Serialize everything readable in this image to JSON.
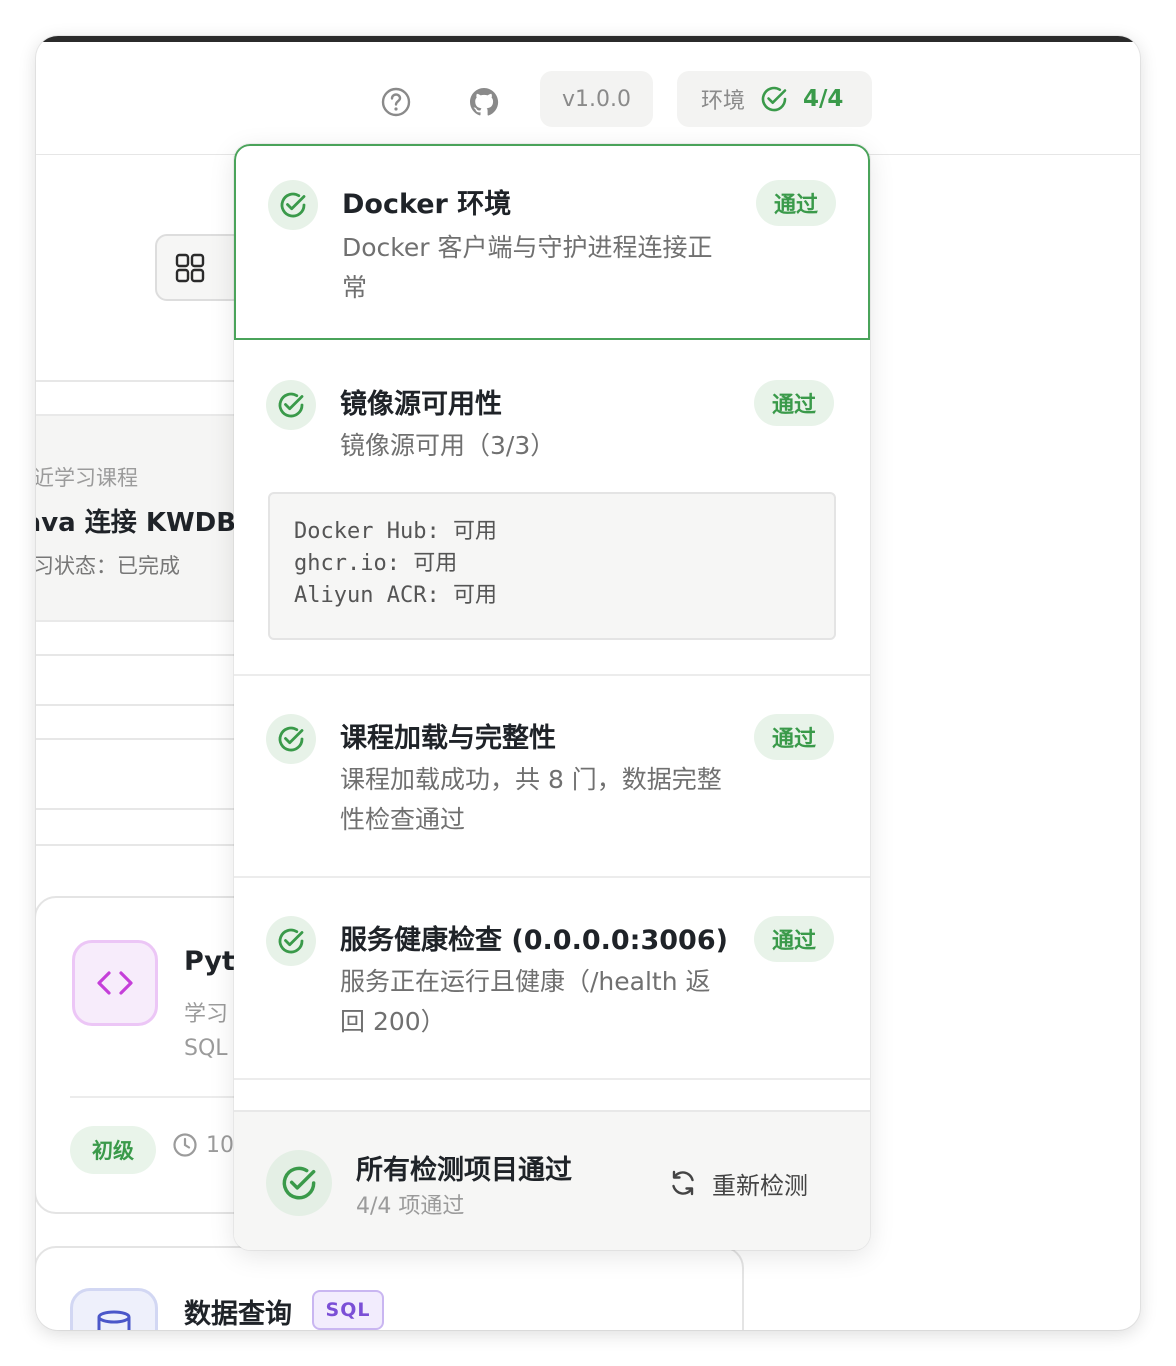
{
  "header": {
    "version": "v1.0.0",
    "env_label": "环境",
    "env_count": "4/4"
  },
  "background": {
    "recent_label": "最近学习课程",
    "recent_title": "Java 连接 KWDB",
    "recent_status": "学习状态：已完成",
    "course_title": "Python",
    "course_sub1": "学习",
    "course_sub2": "SQL",
    "course_level": "初级",
    "course_duration": "10",
    "course2_title": "数据查询",
    "course2_badge": "SQL"
  },
  "checks": [
    {
      "title": "Docker 环境",
      "desc": "Docker 客户端与守护进程连接正常",
      "status": "通过"
    },
    {
      "title": "镜像源可用性",
      "desc": "镜像源可用（3/3）",
      "status": "通过",
      "details": [
        "Docker Hub: 可用",
        "ghcr.io: 可用",
        "Aliyun ACR: 可用"
      ]
    },
    {
      "title": "课程加载与完整性",
      "desc": "课程加载成功，共 8 门，数据完整性检查通过",
      "status": "通过"
    },
    {
      "title": "服务健康检查 (0.0.0.0:3006)",
      "desc": "服务正在运行且健康（/health 返回 200）",
      "status": "通过"
    }
  ],
  "footer": {
    "title": "所有检测项目通过",
    "subtitle": "4/4 项通过",
    "recheck_label": "重新检测"
  },
  "colors": {
    "success": "#3a9a4a",
    "success_bg": "#e8f3e9",
    "border_active": "#4aa35a"
  }
}
